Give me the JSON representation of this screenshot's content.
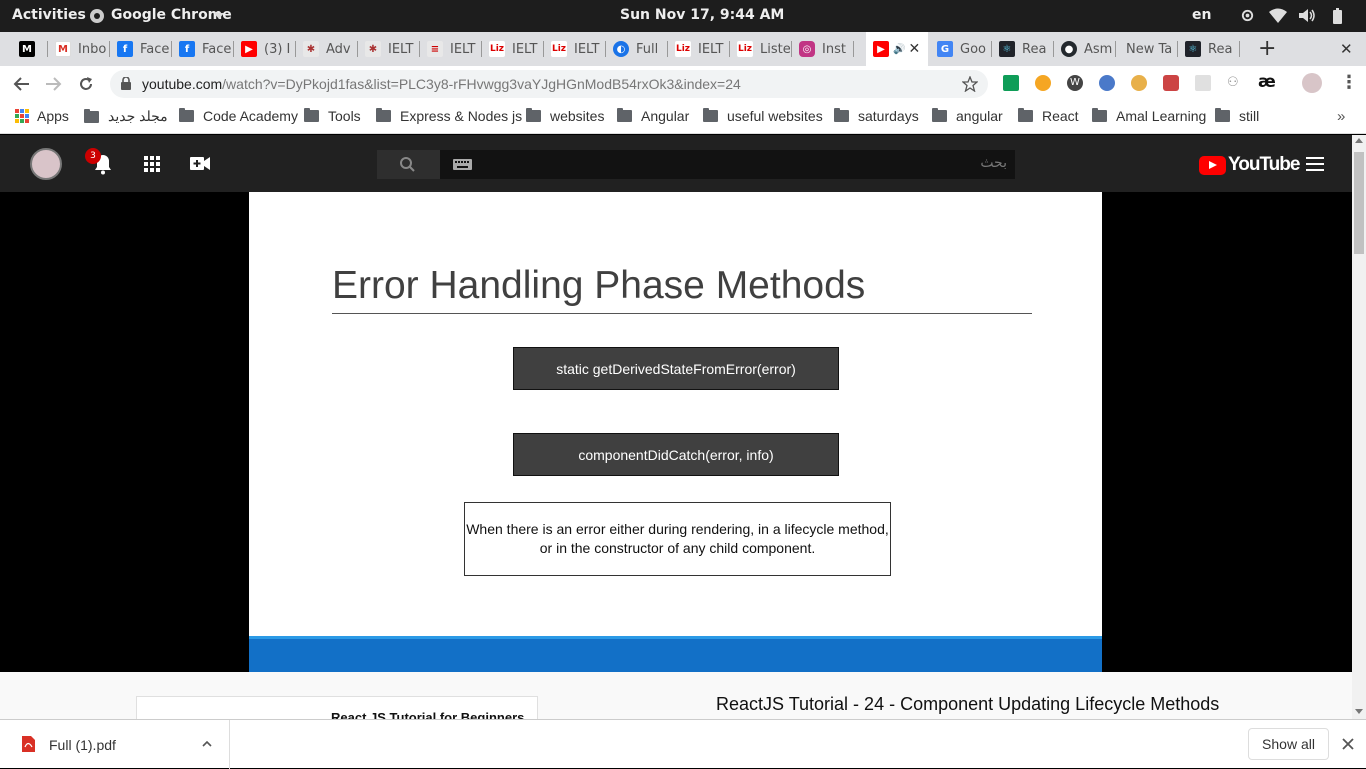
{
  "system_bar": {
    "activities": "Activities",
    "app_name": "Google Chrome",
    "datetime": "Sun Nov 17,  9:44 AM",
    "language": "en"
  },
  "tabs": [
    {
      "icon": "medium-icon",
      "label": "M",
      "title": ""
    },
    {
      "icon": "gmail-icon",
      "label": "",
      "title": "Inbo"
    },
    {
      "icon": "facebook-icon",
      "label": "f",
      "title": "Face"
    },
    {
      "icon": "facebook-icon",
      "label": "f",
      "title": "Face"
    },
    {
      "icon": "youtube-icon",
      "label": "",
      "title": "(3) I"
    },
    {
      "icon": "ielts-icon",
      "label": "",
      "title": "Adv"
    },
    {
      "icon": "ielts-icon",
      "label": "",
      "title": "IELT"
    },
    {
      "icon": "ielts-icon",
      "label": "",
      "title": "IELT"
    },
    {
      "icon": "liz-icon",
      "label": "Liz",
      "title": "IELT"
    },
    {
      "icon": "liz-icon",
      "label": "Liz",
      "title": "IELT"
    },
    {
      "icon": "site-icon",
      "label": "",
      "title": "Full"
    },
    {
      "icon": "liz-icon",
      "label": "Liz",
      "title": "IELT"
    },
    {
      "icon": "liz-icon",
      "label": "Liz",
      "title": "Liste"
    },
    {
      "icon": "instagram-icon",
      "label": "",
      "title": "Inst"
    },
    {
      "icon": "youtube-icon",
      "label": "",
      "title": ""
    },
    {
      "icon": "google-translate-icon",
      "label": "",
      "title": "Goo"
    },
    {
      "icon": "react-icon",
      "label": "",
      "title": "Rea"
    },
    {
      "icon": "github-icon",
      "label": "",
      "title": "Asm"
    },
    {
      "icon": "",
      "label": "",
      "title": "New Tab"
    },
    {
      "icon": "react-icon",
      "label": "",
      "title": "Rea"
    }
  ],
  "address_bar": {
    "domain": "youtube.com",
    "path": "/watch?v=DyPkojd1fas&list=PLC3y8-rFHvwgg3vaYJgHGnModB54rxOk3&index=24"
  },
  "bookmarks": {
    "apps": "Apps",
    "items": [
      "مجلد جديد",
      "Code Academy",
      "Tools",
      "Express & Nodes js",
      "websites",
      "Angular",
      "useful websites",
      "saturdays",
      "angular",
      "React",
      "Amal Learning",
      "still"
    ]
  },
  "youtube": {
    "notification_count": "3",
    "search_placeholder": "بحث",
    "logo_text": "YouTube"
  },
  "slide": {
    "title": "Error Handling Phase Methods",
    "method1": "static getDerivedStateFromError(error)",
    "method2": "componentDidCatch(error, info)",
    "note": "When there is an error either during rendering, in a lifecycle method, or in the constructor of any child component."
  },
  "below_video": {
    "playlist_title": "React JS Tutorial for Beginners",
    "video_title": "ReactJS Tutorial - 24 - Component Updating Lifecycle Methods"
  },
  "download_bar": {
    "file_name": "Full (1).pdf",
    "show_all": "Show all"
  },
  "colors": {
    "youtube_red": "#ff0000",
    "slide_box": "#404040",
    "slide_band": "#1270c7"
  }
}
